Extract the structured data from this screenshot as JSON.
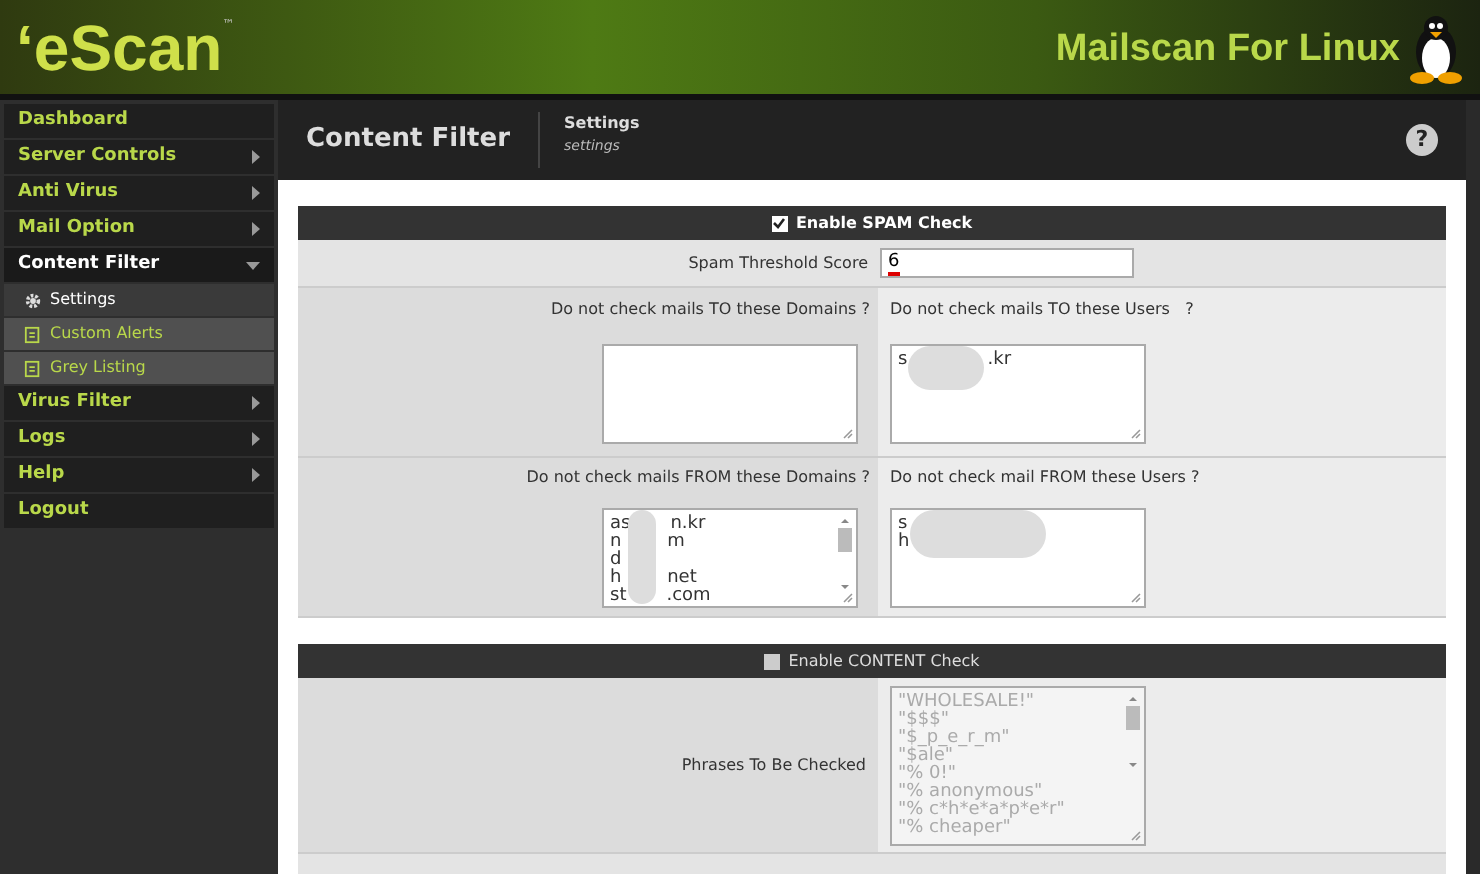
{
  "header": {
    "logo": "‘eScan",
    "trademark": "™",
    "product": "Mailscan For Linux"
  },
  "sidebar": {
    "items": [
      {
        "label": "Dashboard",
        "has_arrow": false,
        "expanded": false
      },
      {
        "label": "Server Controls",
        "has_arrow": true,
        "expanded": false
      },
      {
        "label": "Anti Virus",
        "has_arrow": true,
        "expanded": false
      },
      {
        "label": "Mail Option",
        "has_arrow": true,
        "expanded": false
      },
      {
        "label": "Content Filter",
        "has_arrow": true,
        "expanded": true,
        "children": [
          {
            "label": "Settings",
            "kind": "gear",
            "selected": true
          },
          {
            "label": "Custom Alerts",
            "kind": "page",
            "selected": false
          },
          {
            "label": "Grey Listing",
            "kind": "page",
            "selected": false
          }
        ]
      },
      {
        "label": "Virus Filter",
        "has_arrow": true,
        "expanded": false
      },
      {
        "label": "Logs",
        "has_arrow": true,
        "expanded": false
      },
      {
        "label": "Help",
        "has_arrow": true,
        "expanded": false
      },
      {
        "label": "Logout",
        "has_arrow": false,
        "expanded": false
      }
    ]
  },
  "page_header": {
    "title": "Content Filter",
    "section": "Settings",
    "subtitle": "settings",
    "help": "?"
  },
  "spam_panel": {
    "label": "Enable SPAM Check",
    "checked": true,
    "threshold": {
      "label": "Spam Threshold Score",
      "value": "6"
    },
    "to_domains": {
      "label": "Do not check mails TO these Domains ?"
    },
    "to_users": {
      "label": "Do not check mails TO these Users   ?",
      "lines": [
        "s              .kr"
      ]
    },
    "from_domains": {
      "label": "Do not check mails FROM these Domains ?",
      "lines": [
        "as       n.kr",
        "n        m",
        "d",
        "h        net",
        "st       .com"
      ]
    },
    "from_users": {
      "label": "Do not check mail FROM these Users ?",
      "lines": [
        "s",
        "h"
      ]
    }
  },
  "content_panel": {
    "label": "Enable CONTENT Check",
    "checked": false,
    "phrases": {
      "label": "Phrases To Be Checked",
      "disabled": true,
      "lines": [
        "\"WHOLESALE!\"",
        "\"$$$\"",
        "\"$_p_e_r_m\"",
        "\"$ale\"",
        "\"% 0!\"",
        "\"% anonymous\"",
        "\"% c*h*e*a*p*e*r\"",
        "\"% cheaper\""
      ]
    }
  }
}
